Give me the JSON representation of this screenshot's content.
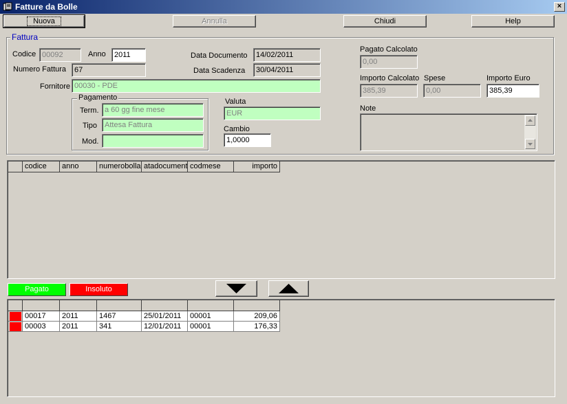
{
  "window": {
    "title": "Fatture da Bolle",
    "close_glyph": "×",
    "icon": "app-icon"
  },
  "toolbar": {
    "nuova_label": "Nuova",
    "annulla_label": "Annulla",
    "chiudi_label": "Chiudi",
    "help_label": "Help"
  },
  "fattura": {
    "group_label": "Fattura",
    "codice_label": "Codice",
    "codice_value": "00092",
    "anno_label": "Anno",
    "anno_value": "2011",
    "numero_label": "Numero Fattura",
    "numero_value": "67",
    "data_documento_label": "Data Documento",
    "data_documento_value": "14/02/2011",
    "data_scadenza_label": "Data Scadenza",
    "data_scadenza_value": "30/04/2011",
    "fornitore_label": "Fornitore",
    "fornitore_value": "00030 - PDE",
    "pagamento": {
      "group_label": "Pagamento",
      "term_label": "Term.",
      "term_value": "a 60 gg fine mese",
      "tipo_label": "Tipo",
      "tipo_value": "Attesa Fattura",
      "mod_label": "Mod.",
      "mod_value": ""
    },
    "valuta_label": "Valuta",
    "valuta_value": "EUR",
    "cambio_label": "Cambio",
    "cambio_value": "1,0000",
    "pagato_calcolato_label": "Pagato Calcolato",
    "pagato_calcolato_value": "0,00",
    "importo_calcolato_label": "Importo Calcolato",
    "importo_calcolato_value": "385,39",
    "spese_label": "Spese",
    "spese_value": "0,00",
    "importo_euro_label": "Importo Euro",
    "importo_euro_value": "385,39",
    "note_label": "Note",
    "note_value": ""
  },
  "top_grid": {
    "columns": [
      "codice",
      "anno",
      "numerobolla",
      "atadocument",
      "codmese",
      "importo"
    ],
    "rows": []
  },
  "legend_buttons": {
    "pagato_label": "Pagato",
    "pagato_color": "#00ff00",
    "insoluto_label": "Insoluto",
    "insoluto_color": "#ff0000"
  },
  "move_buttons": {
    "down_icon": "triangle-down-icon",
    "up_icon": "triangle-up-icon"
  },
  "bottom_grid": {
    "columns": [
      "",
      "",
      "",
      "",
      "",
      ""
    ],
    "rows": [
      {
        "status_color": "#ff0000",
        "cells": [
          "00017",
          "2011",
          "1467",
          "25/01/2011",
          "00001",
          "209,06"
        ]
      },
      {
        "status_color": "#ff0000",
        "cells": [
          "00003",
          "2011",
          "341",
          "12/01/2011",
          "00001",
          "176,33"
        ]
      }
    ]
  }
}
